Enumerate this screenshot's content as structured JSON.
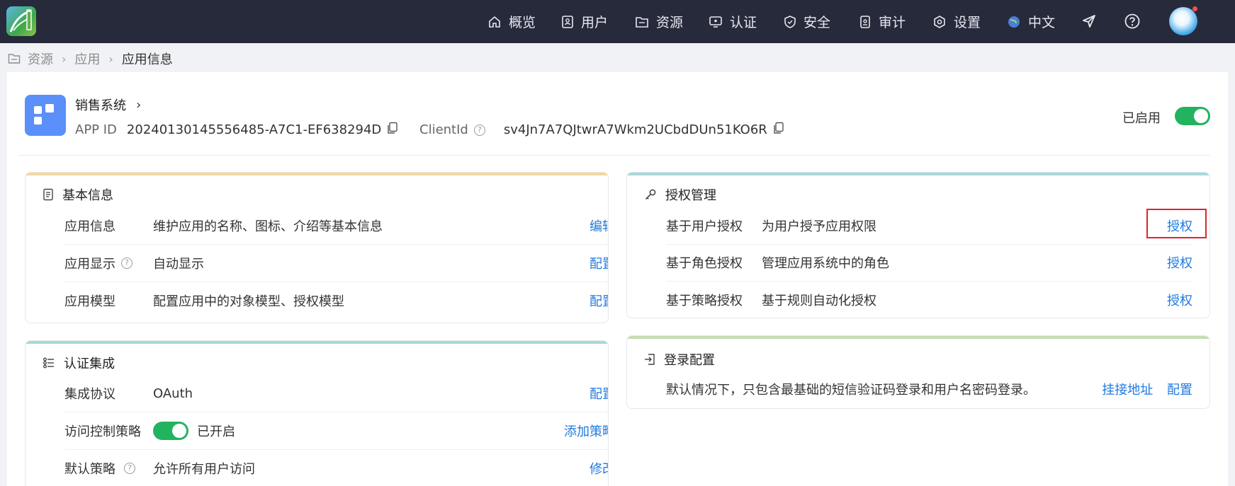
{
  "nav": {
    "items": [
      {
        "label": "概览",
        "icon": "home-icon"
      },
      {
        "label": "用户",
        "icon": "user-icon"
      },
      {
        "label": "资源",
        "icon": "folder-icon"
      },
      {
        "label": "认证",
        "icon": "monitor-icon"
      },
      {
        "label": "安全",
        "icon": "shield-icon"
      },
      {
        "label": "审计",
        "icon": "audit-icon"
      },
      {
        "label": "设置",
        "icon": "settings-icon"
      },
      {
        "label": "中文",
        "icon": "globe-icon"
      }
    ]
  },
  "breadcrumb": {
    "items": [
      "资源",
      "应用",
      "应用信息"
    ]
  },
  "app": {
    "name": "销售系统",
    "chevron": "›",
    "appid_label": "APP ID",
    "appid_value": "20240130145556485-A7C1-EF638294D",
    "clientid_label": "ClientId",
    "clientid_value": "sv4Jn7A7QJtwrA7Wkm2UCbdDUn51KO6R",
    "status_label": "已启用",
    "question_glyph": "?"
  },
  "basic_info": {
    "title": "基本信息",
    "rows": [
      {
        "label": "应用信息",
        "desc": "维护应用的名称、图标、介绍等基本信息",
        "action": "编辑"
      },
      {
        "label": "应用显示",
        "desc": "自动显示",
        "action": "配置"
      },
      {
        "label": "应用模型",
        "desc": "配置应用中的对象模型、授权模型",
        "action": "配置"
      }
    ]
  },
  "auth_integration": {
    "title": "认证集成",
    "rows": [
      {
        "label": "集成协议",
        "desc": "OAuth",
        "action": "配置"
      },
      {
        "label": "访问控制策略",
        "desc": "已开启",
        "action": "添加策略"
      },
      {
        "label": "默认策略",
        "desc": "允许所有用户访问",
        "action": "修改"
      }
    ]
  },
  "authorization": {
    "title": "授权管理",
    "rows": [
      {
        "label": "基于用户授权",
        "desc": "为用户授予应用权限",
        "action": "授权"
      },
      {
        "label": "基于角色授权",
        "desc": "管理应用系统中的角色",
        "action": "授权"
      },
      {
        "label": "基于策略授权",
        "desc": "基于规则自动化授权",
        "action": "授权"
      }
    ]
  },
  "login_config": {
    "title": "登录配置",
    "desc": "默认情况下，只包含最基础的短信验证码登录和用户名密码登录。",
    "action_link": "挂接地址",
    "action_config": "配置"
  },
  "colors": {
    "accent": "#1f7ae0",
    "toggle_on": "#22b35e",
    "topbar": "#272a3b",
    "basic_top": "#f5d79e",
    "auth_top": "#a8d8d8",
    "login_top": "#c5dcb0",
    "highlight": "#e0242c"
  }
}
